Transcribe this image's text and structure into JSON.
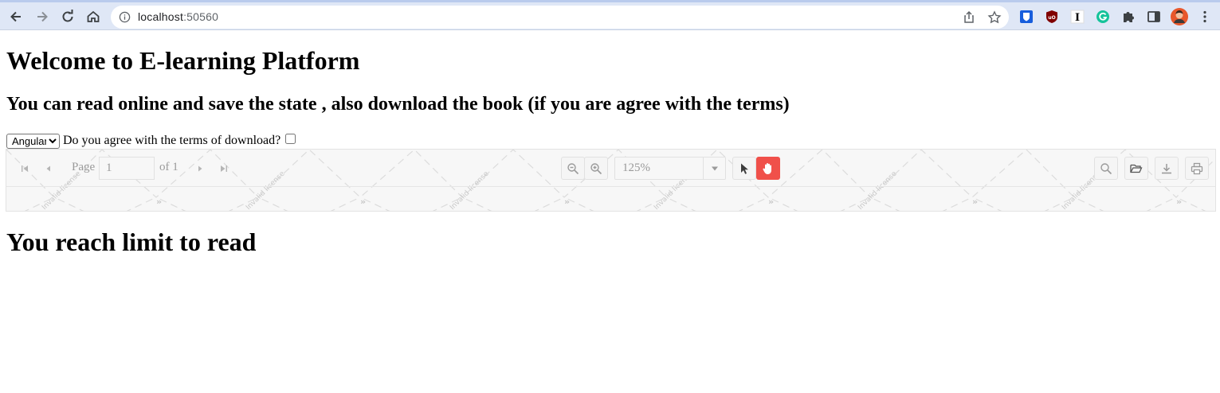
{
  "browser": {
    "url_host": "localhost",
    "url_port": ":50560",
    "icons": {
      "back": "back-arrow-icon",
      "forward": "forward-arrow-icon",
      "reload": "reload-icon",
      "home": "home-icon",
      "site_info": "info-icon",
      "share": "share-icon",
      "bookmark": "star-icon",
      "extensions": [
        "bitwarden-icon",
        "ublock-icon",
        "instapaper-icon",
        "grammarly-icon",
        "puzzle-icon",
        "side-panel-icon",
        "avatar",
        "more-menu-icon"
      ]
    }
  },
  "page": {
    "title": "Welcome to E-learning Platform",
    "subtitle": "You can read online and save the state , also download the book (if you are agree with the terms)",
    "framework_select": {
      "selected": "Angular",
      "options": [
        "Angular"
      ]
    },
    "agree_label": "Do you agree with the terms of download?",
    "agree_checked": false,
    "limit_message": "You reach limit to read"
  },
  "viewer": {
    "page_label": "Page",
    "page_value": "1",
    "page_of": "of 1",
    "zoom_value": "125%",
    "watermark_text": "Invalid license",
    "accent_color": "#f0504a"
  }
}
